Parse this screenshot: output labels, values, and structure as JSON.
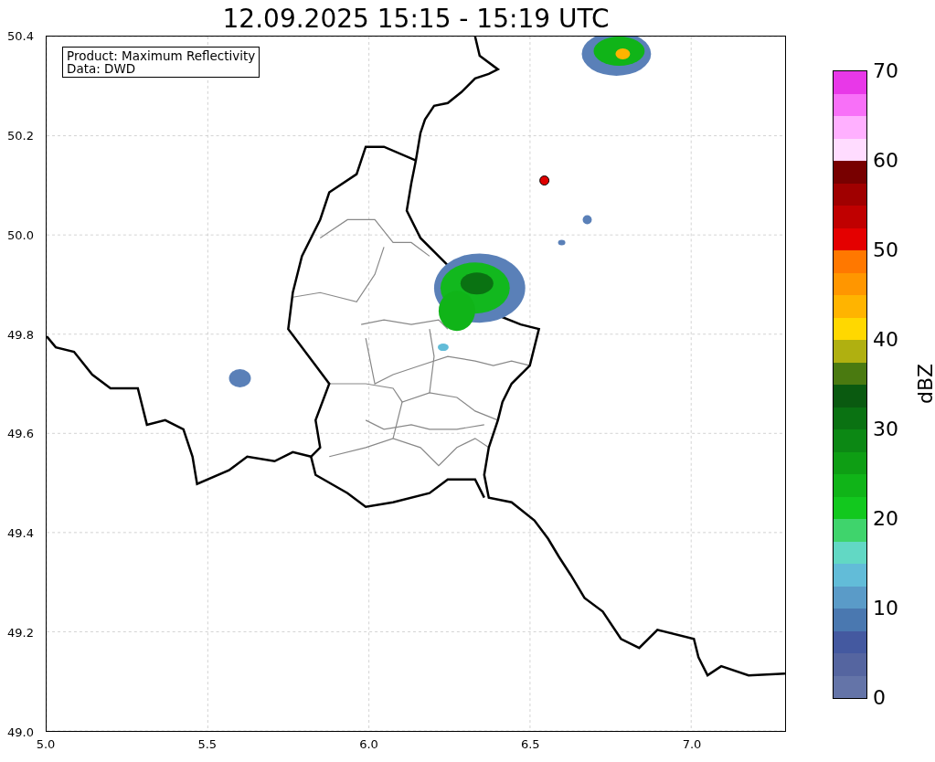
{
  "title": "12.09.2025 15:15 - 15:19 UTC",
  "info_box": {
    "lines": [
      "Product: Maximum Reflectivity",
      "Data: DWD"
    ]
  },
  "map": {
    "xticks": [
      "5.0",
      "5.5",
      "6.0",
      "6.5",
      "7.0"
    ],
    "yticks": [
      "50.4",
      "50.2",
      "50.0",
      "49.8",
      "49.6",
      "49.4",
      "49.2",
      "49.0"
    ]
  },
  "colorbar": {
    "label": "dBZ",
    "ticks": [
      "70",
      "60",
      "50",
      "40",
      "30",
      "20",
      "10",
      "0"
    ],
    "segments": [
      {
        "color": "#6474a8"
      },
      {
        "color": "#5565a0"
      },
      {
        "color": "#4459a0"
      },
      {
        "color": "#4a78b0"
      },
      {
        "color": "#5a9bc8"
      },
      {
        "color": "#62bcd8"
      },
      {
        "color": "#62d8c4"
      },
      {
        "color": "#3fd46c"
      },
      {
        "color": "#12c81e"
      },
      {
        "color": "#10b418"
      },
      {
        "color": "#0e9e14"
      },
      {
        "color": "#0c8814"
      },
      {
        "color": "#0a7212"
      },
      {
        "color": "#0a5a10"
      },
      {
        "color": "#4a7a10"
      },
      {
        "color": "#b0b010"
      },
      {
        "color": "#ffd800"
      },
      {
        "color": "#ffb400"
      },
      {
        "color": "#ff9600"
      },
      {
        "color": "#ff7800"
      },
      {
        "color": "#e40000"
      },
      {
        "color": "#c00000"
      },
      {
        "color": "#a00000"
      },
      {
        "color": "#780000"
      },
      {
        "color": "#ffdcff"
      },
      {
        "color": "#ffb0ff"
      },
      {
        "color": "#f870f8"
      },
      {
        "color": "#e838e8"
      }
    ]
  }
}
